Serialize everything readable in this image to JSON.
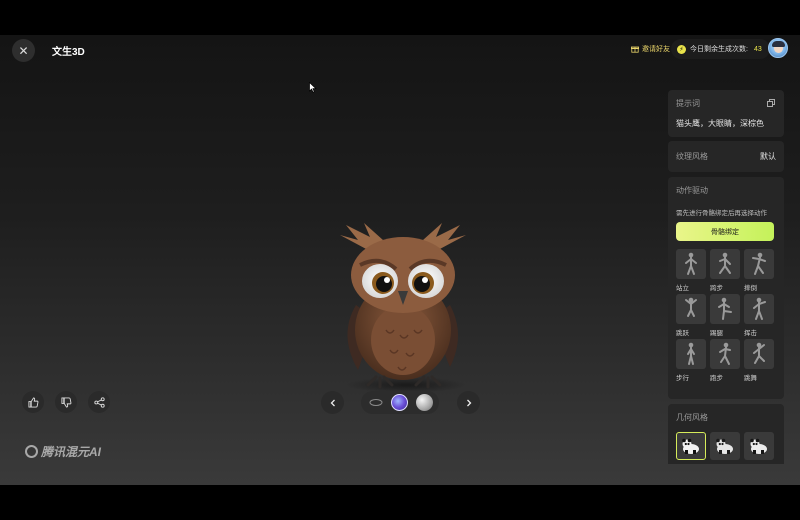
{
  "header": {
    "title": "文生3D",
    "invite_label": "邀请好友",
    "quota_label": "今日剩余生成次数:",
    "quota_value": "43"
  },
  "viewer": {
    "subject_icon": "owl-3d-model"
  },
  "actions": {
    "like_icon": "thumbs-up-icon",
    "dislike_icon": "thumbs-down-icon",
    "share_icon": "share-icon"
  },
  "watermark": "腾讯混元AI",
  "panel": {
    "prompt_label": "提示词",
    "prompt_text": "猫头鹰，大眼睛，深棕色",
    "texture_label": "纹理风格",
    "texture_value": "默认",
    "motion_label": "动作驱动",
    "motion_hint": "需先进行骨骼绑定后再选择动作",
    "bind_button": "骨骼绑定",
    "motions": [
      {
        "label": "站立"
      },
      {
        "label": "跨步"
      },
      {
        "label": "摔倒"
      },
      {
        "label": "跳跃"
      },
      {
        "label": "踢腿"
      },
      {
        "label": "挥击"
      },
      {
        "label": "步行"
      },
      {
        "label": "跑步"
      },
      {
        "label": "跳舞"
      }
    ],
    "geometry_label": "几何风格",
    "geometry_options": [
      "panda-style-1",
      "panda-style-2",
      "panda-style-3"
    ]
  },
  "colors": {
    "accent": "#d6ec5a",
    "quota": "#e8e24a",
    "invite": "#e9d46a"
  }
}
